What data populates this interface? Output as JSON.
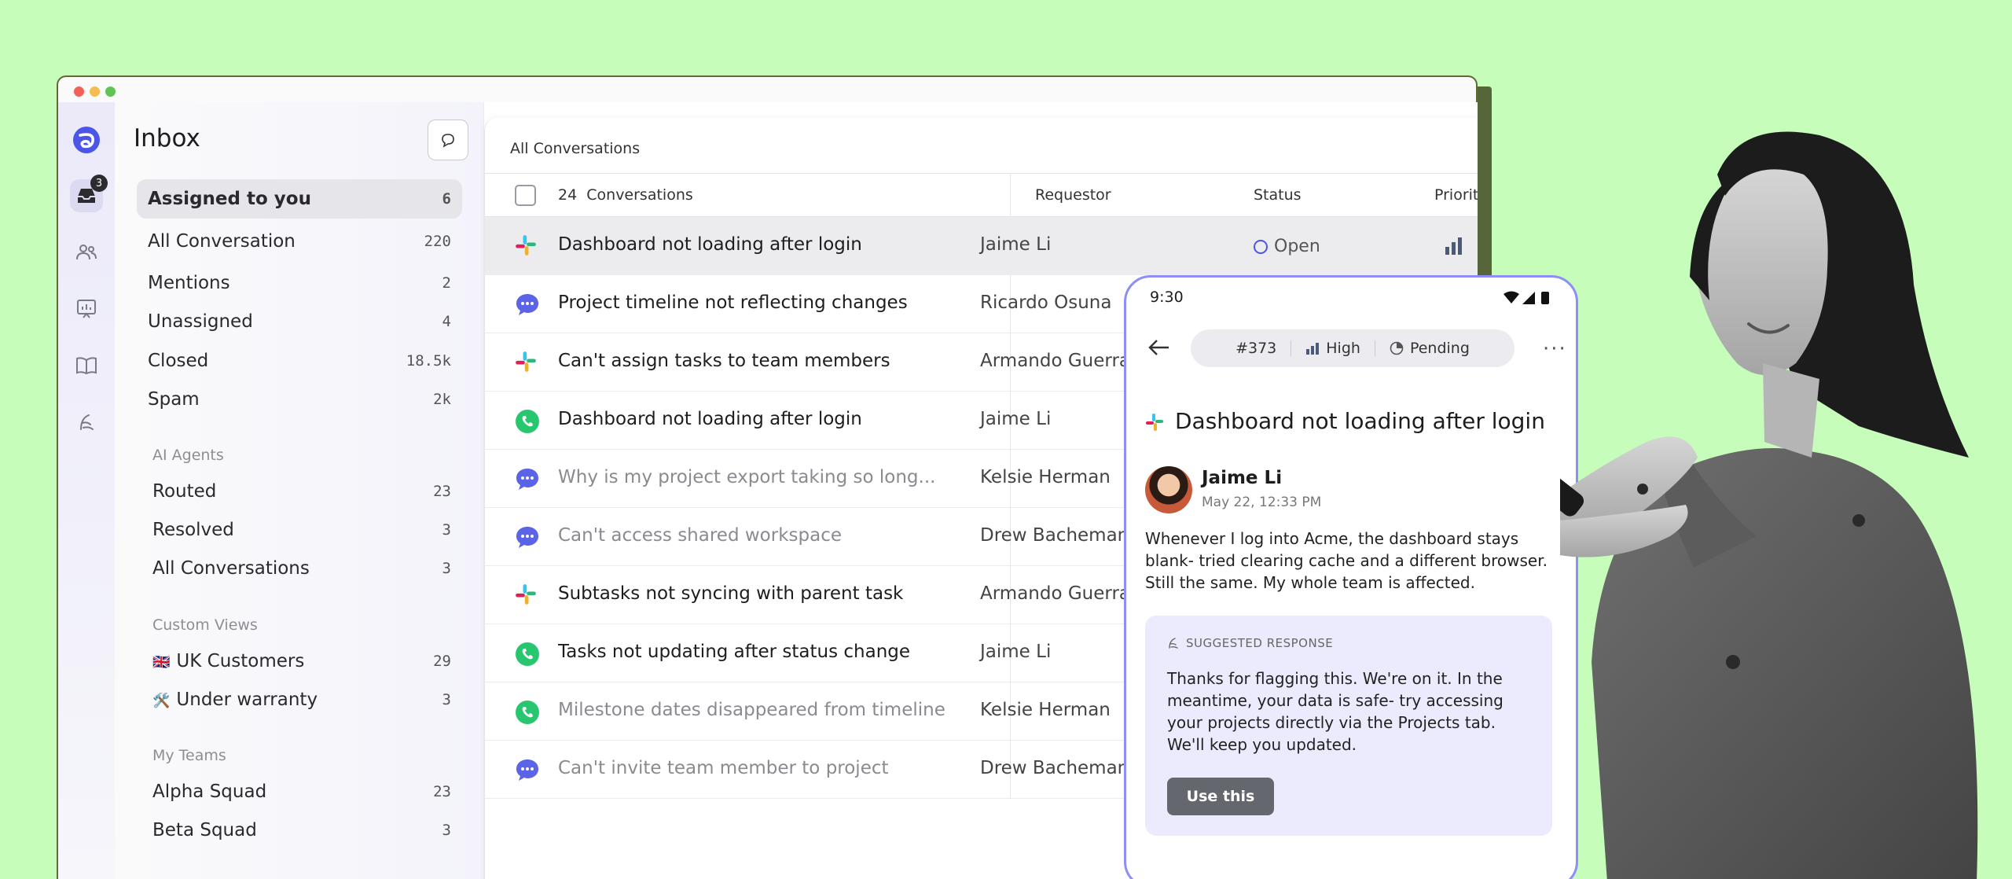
{
  "sidebar": {
    "title": "Inbox",
    "inbox_badge": "3",
    "items": [
      {
        "label": "Assigned to you",
        "count": "6"
      },
      {
        "label": "All Conversation",
        "count": "220"
      },
      {
        "label": "Mentions",
        "count": "2"
      },
      {
        "label": "Unassigned",
        "count": "4"
      },
      {
        "label": "Closed",
        "count": "18.5k"
      },
      {
        "label": "Spam",
        "count": "2k"
      }
    ],
    "ai_agents": {
      "heading": "AI Agents",
      "items": [
        {
          "label": "Routed",
          "count": "23"
        },
        {
          "label": "Resolved",
          "count": "3"
        },
        {
          "label": "All Conversations",
          "count": "3"
        }
      ]
    },
    "custom_views": {
      "heading": "Custom Views",
      "items": [
        {
          "emoji": "🇬🇧",
          "label": "UK Customers",
          "count": "29"
        },
        {
          "emoji": "🛠️",
          "label": "Under warranty",
          "count": "3"
        }
      ]
    },
    "my_teams": {
      "heading": "My Teams",
      "items": [
        {
          "label": "Alpha Squad",
          "count": "23"
        },
        {
          "label": "Beta Squad",
          "count": "3"
        }
      ]
    }
  },
  "list": {
    "view_title": "All Conversations",
    "count_label": "24  Conversations",
    "columns": {
      "requestor": "Requestor",
      "status": "Status",
      "priority": "Priority"
    },
    "rows": [
      {
        "channel": "slack",
        "subject": "Dashboard not loading after login",
        "requestor": "Jaime Li",
        "status": "Open"
      },
      {
        "channel": "chat",
        "subject": "Project timeline not reflecting changes",
        "requestor": "Ricardo Osuna"
      },
      {
        "channel": "slack",
        "subject": "Can't assign tasks to team members",
        "requestor": "Armando Guerra"
      },
      {
        "channel": "whatsapp",
        "subject": "Dashboard not loading after login",
        "requestor": "Jaime Li"
      },
      {
        "channel": "chat",
        "subject": "Why is my project export taking so long...",
        "requestor": "Kelsie Herman"
      },
      {
        "channel": "chat",
        "subject": "Can't access shared workspace",
        "requestor": "Drew Bacheman"
      },
      {
        "channel": "slack",
        "subject": "Subtasks not syncing with parent task",
        "requestor": "Armando Guerra"
      },
      {
        "channel": "whatsapp",
        "subject": "Tasks not updating after status change",
        "requestor": "Jaime Li"
      },
      {
        "channel": "whatsapp",
        "subject": "Milestone dates disappeared from timeline",
        "requestor": "Kelsie Herman"
      },
      {
        "channel": "chat",
        "subject": "Can't invite team member to project",
        "requestor": "Drew Bacheman"
      }
    ]
  },
  "phone": {
    "time": "9:30",
    "ticket_id": "#373",
    "priority": "High",
    "status": "Pending",
    "title": "Dashboard not loading after login",
    "sender": "Jaime Li",
    "date": "May 22, 12:33 PM",
    "message": "Whenever I log into Acme, the dashboard stays blank- tried clearing cache and a different browser. Still the same. My whole team is affected.",
    "suggested_heading": "SUGGESTED RESPONSE",
    "suggested_text": "Thanks for flagging this. We're on it. In the meantime, your data is safe- try accessing your projects directly via the Projects tab. We'll keep you updated.",
    "use_button": "Use this"
  },
  "colors": {
    "background": "#c7fdbb",
    "accent": "#4b55e8",
    "selected_row": "#ececee",
    "whatsapp": "#28c76f",
    "chat": "#5b63e6",
    "suggest_bg": "#ebebfd",
    "phone_border": "#8d8ff4"
  }
}
